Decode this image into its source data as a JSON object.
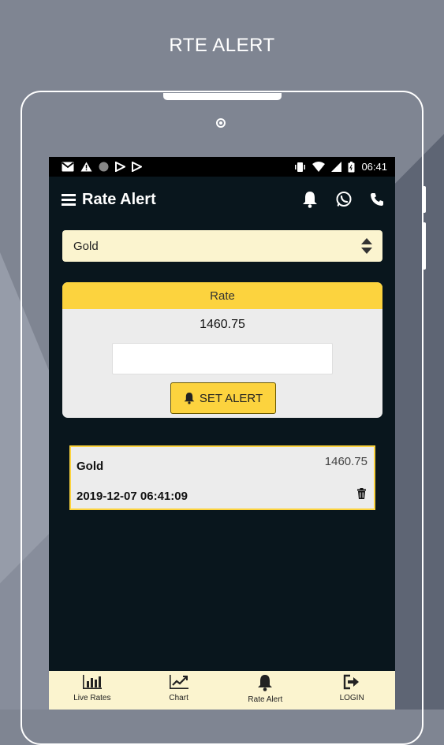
{
  "promo": {
    "title": "RTE ALERT"
  },
  "statusbar": {
    "time": "06:41"
  },
  "appbar": {
    "title": "Rate Alert"
  },
  "metal_select": {
    "selected": "Gold"
  },
  "rate_card": {
    "header": "Rate",
    "current_rate": "1460.75",
    "input_value": "",
    "button_label": "SET ALERT"
  },
  "alerts": [
    {
      "name": "Gold",
      "rate": "1460.75",
      "datetime": "2019-12-07 06:41:09"
    }
  ],
  "bottom_nav": {
    "items": [
      {
        "label": "Live Rates",
        "icon": "bar-chart-icon"
      },
      {
        "label": "Chart",
        "icon": "line-chart-icon"
      },
      {
        "label": "Rate Alert",
        "icon": "bell-icon"
      },
      {
        "label": "LOGIN",
        "icon": "login-icon"
      }
    ]
  },
  "colors": {
    "accent": "#fcd33e",
    "screen_bg": "#09161d",
    "field_bg": "#fbf4cf"
  }
}
